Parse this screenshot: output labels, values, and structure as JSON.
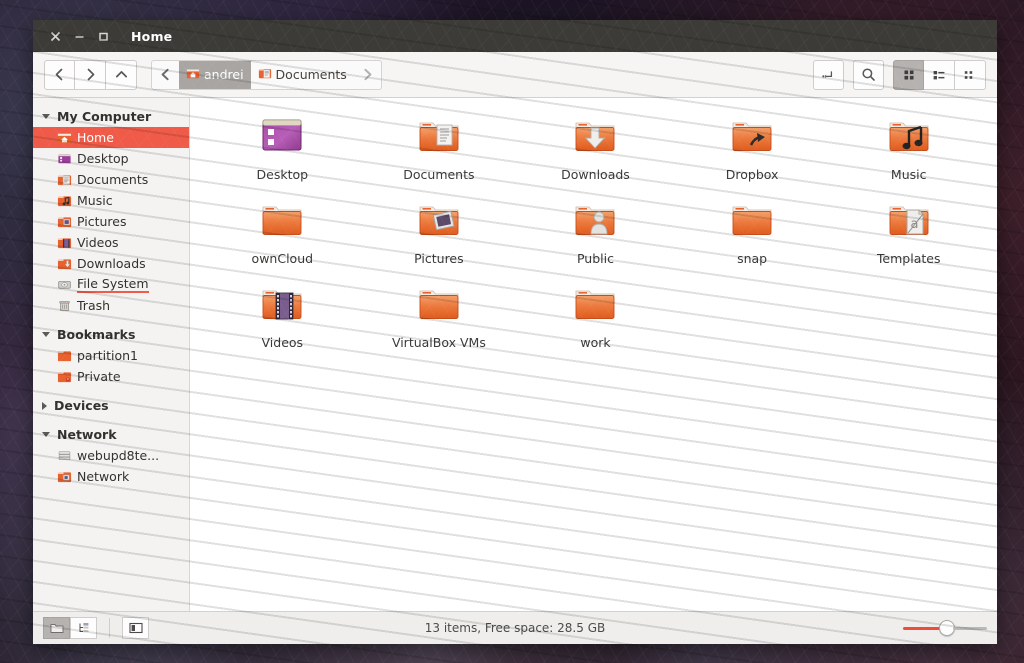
{
  "window": {
    "title": "Home",
    "controls": {
      "close": "close-icon",
      "minimize": "minimize-icon",
      "maximize": "maximize-icon"
    }
  },
  "toolbar": {
    "back_label": "Back",
    "forward_label": "Forward",
    "up_label": "Up",
    "path_entry_label": "Toggle location entry",
    "search_label": "Search",
    "view_icon_label": "Icon view",
    "view_list_label": "List view",
    "view_compact_label": "Compact view",
    "breadcrumb_prev_label": "Previous path",
    "breadcrumb_next_label": "Next path",
    "breadcrumbs": [
      {
        "label": "andrei",
        "icon": "home-folder-icon",
        "current": true
      },
      {
        "label": "Documents",
        "icon": "documents-folder-icon",
        "current": false
      }
    ]
  },
  "sidebar": {
    "groups": [
      {
        "title": "My Computer",
        "expanded": true,
        "items": [
          {
            "label": "Home",
            "icon": "home-folder-icon",
            "selected": true
          },
          {
            "label": "Desktop",
            "icon": "desktop-icon",
            "selected": false
          },
          {
            "label": "Documents",
            "icon": "documents-folder-icon",
            "selected": false
          },
          {
            "label": "Music",
            "icon": "music-folder-icon",
            "selected": false
          },
          {
            "label": "Pictures",
            "icon": "pictures-folder-icon",
            "selected": false
          },
          {
            "label": "Videos",
            "icon": "videos-folder-icon",
            "selected": false
          },
          {
            "label": "Downloads",
            "icon": "downloads-folder-icon",
            "selected": false
          },
          {
            "label": "File System",
            "icon": "harddisk-icon",
            "selected": false,
            "hover": true
          },
          {
            "label": "Trash",
            "icon": "trash-icon",
            "selected": false
          }
        ]
      },
      {
        "title": "Bookmarks",
        "expanded": true,
        "items": [
          {
            "label": "partition1",
            "icon": "folder-icon",
            "selected": false
          },
          {
            "label": "Private",
            "icon": "private-folder-icon",
            "selected": false
          }
        ]
      },
      {
        "title": "Devices",
        "expanded": false,
        "items": []
      },
      {
        "title": "Network",
        "expanded": true,
        "items": [
          {
            "label": "webupd8te...",
            "icon": "server-icon",
            "selected": false
          },
          {
            "label": "Network",
            "icon": "network-folder-icon",
            "selected": false
          }
        ]
      }
    ]
  },
  "files": [
    {
      "name": "Desktop",
      "icon": "desktop-icon"
    },
    {
      "name": "Documents",
      "icon": "documents-folder-icon"
    },
    {
      "name": "Downloads",
      "icon": "downloads-folder-icon"
    },
    {
      "name": "Dropbox",
      "icon": "symlink-folder-icon"
    },
    {
      "name": "Music",
      "icon": "music-folder-icon"
    },
    {
      "name": "ownCloud",
      "icon": "folder-icon"
    },
    {
      "name": "Pictures",
      "icon": "pictures-folder-icon"
    },
    {
      "name": "Public",
      "icon": "public-folder-icon"
    },
    {
      "name": "snap",
      "icon": "folder-icon"
    },
    {
      "name": "Templates",
      "icon": "templates-folder-icon"
    },
    {
      "name": "Videos",
      "icon": "videos-folder-icon"
    },
    {
      "name": "VirtualBox VMs",
      "icon": "folder-icon"
    },
    {
      "name": "work",
      "icon": "folder-icon"
    }
  ],
  "statusbar": {
    "text": "13 items, Free space: 28.5 GB",
    "folder_view_label": "Folder view",
    "tree_view_label": "Tree view",
    "sidebar_toggle_label": "Toggle sidebar",
    "zoom_value": 45
  },
  "colors": {
    "titlebar": "#3c3b37",
    "accent": "#ef5b48",
    "slider_fill": "#ef4b36",
    "toolbar": "#f6f5f4",
    "sidebar": "#f4f3f2",
    "content": "#ffffff",
    "statusbar": "#efeeec"
  }
}
